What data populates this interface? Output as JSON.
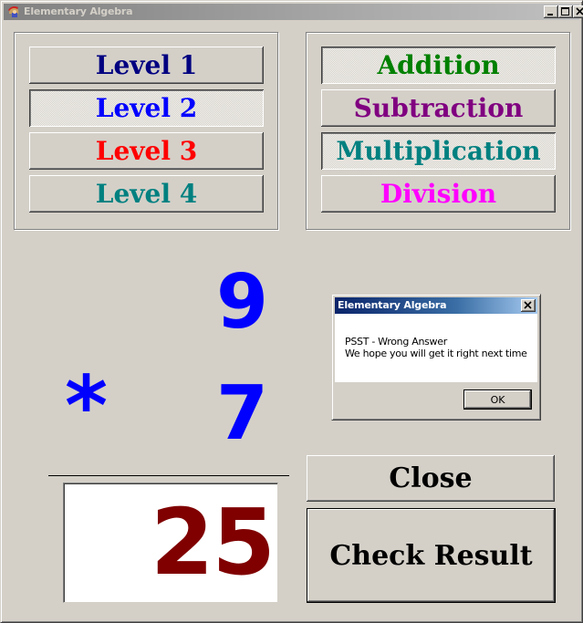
{
  "window": {
    "title": "Elementary Algebra",
    "app_icon": "spartan-helmet-icon",
    "controls": {
      "minimize": "minimize-icon",
      "maximize": "maximize-icon",
      "close": "close-icon"
    }
  },
  "levels": [
    {
      "label": "Level 1",
      "color": "#000080",
      "pressed": false
    },
    {
      "label": "Level 2",
      "color": "#0000ff",
      "pressed": true
    },
    {
      "label": "Level 3",
      "color": "#ff0000",
      "pressed": false
    },
    {
      "label": "Level 4",
      "color": "#008080",
      "pressed": false
    }
  ],
  "operations": [
    {
      "label": "Addition",
      "color": "#008000",
      "pressed": true
    },
    {
      "label": "Subtraction",
      "color": "#800080",
      "pressed": false
    },
    {
      "label": "Multiplication",
      "color": "#008080",
      "pressed": true
    },
    {
      "label": "Division",
      "color": "#ff00ff",
      "pressed": false
    }
  ],
  "problem": {
    "operand1": "9",
    "operator": "*",
    "operand2": "7",
    "answer": "25",
    "operand_color": "#0000ff",
    "answer_color": "#800000"
  },
  "buttons": {
    "close": "Close",
    "check_result": "Check Result"
  },
  "dialog": {
    "title": "Elementary Algebra",
    "line1": "PSST - Wrong Answer",
    "line2": "We hope you will get it right next time",
    "ok": "OK"
  }
}
